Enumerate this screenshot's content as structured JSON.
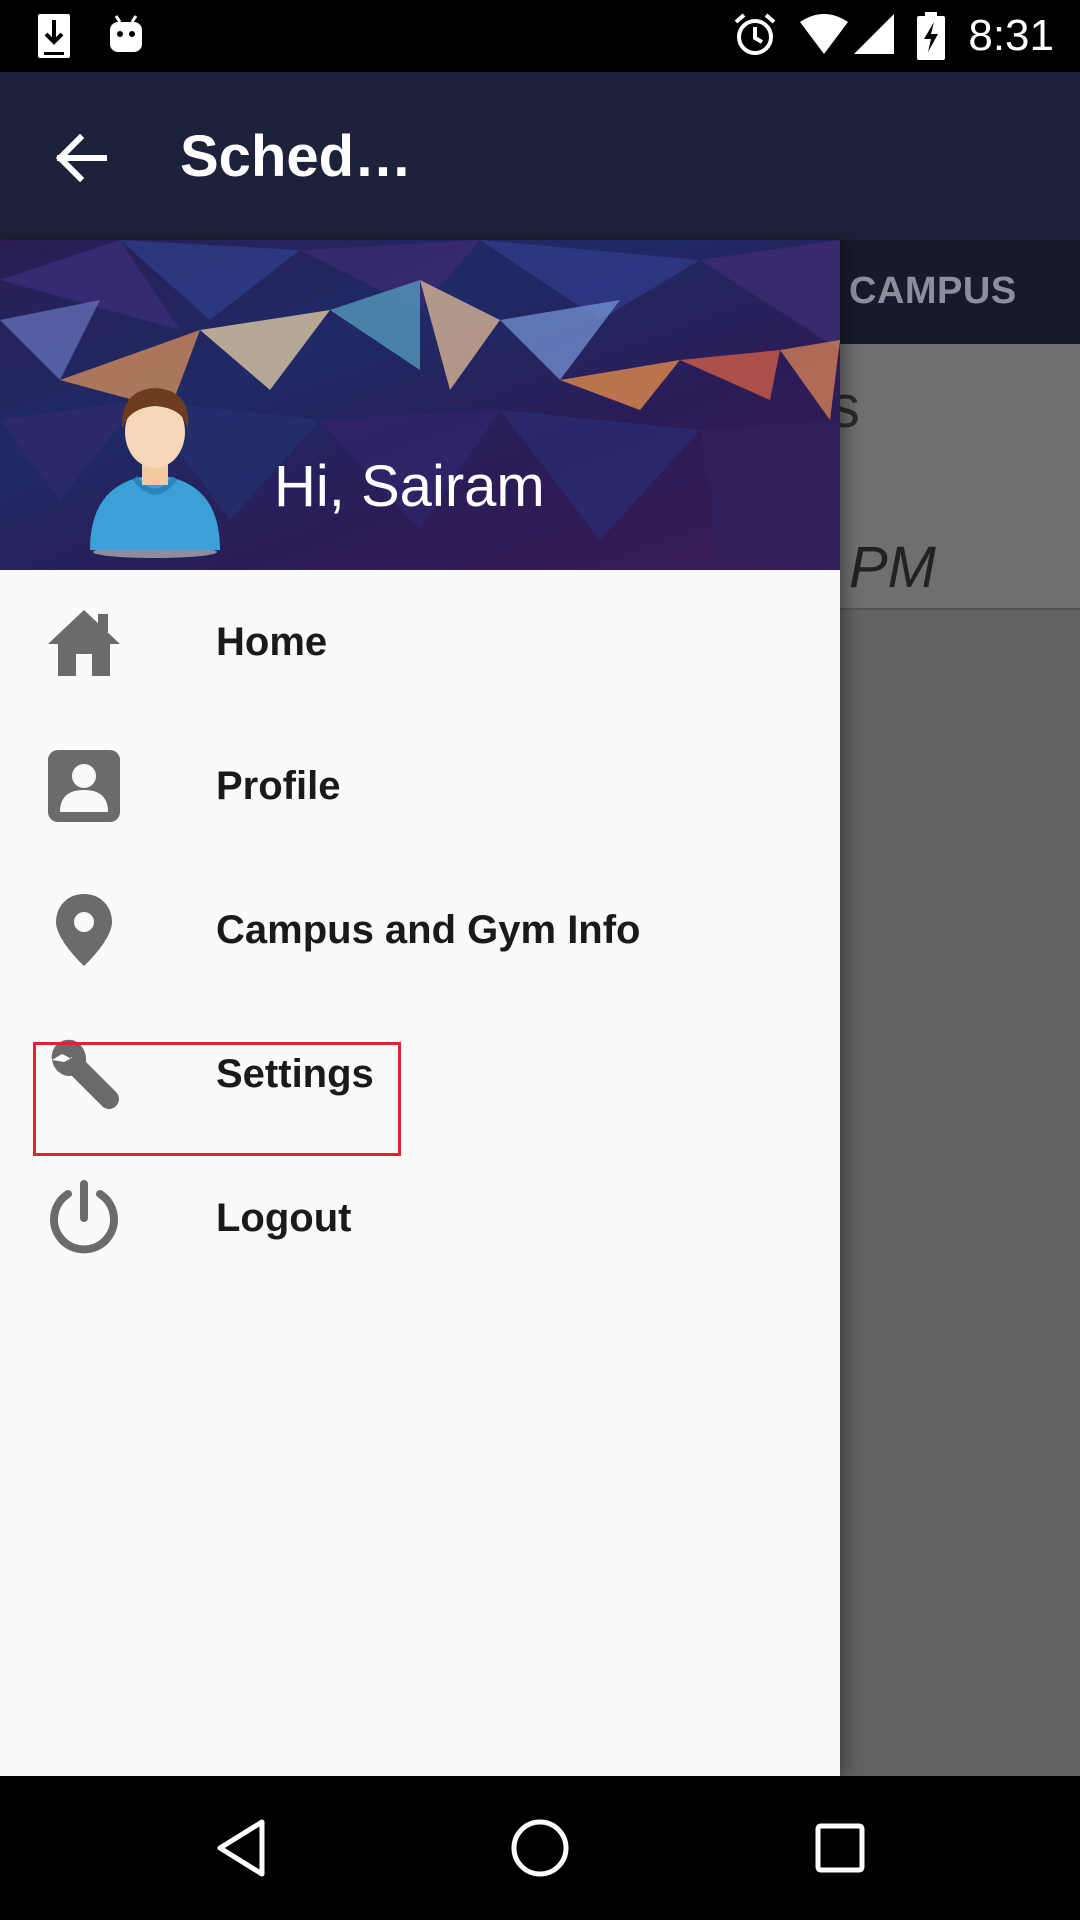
{
  "status_bar": {
    "time": "8:31",
    "icons": [
      "download-icon",
      "android-icon",
      "alarm-icon",
      "wifi-icon",
      "signal-icon",
      "battery-charging-icon"
    ]
  },
  "toolbar": {
    "title": "Sched…",
    "back_icon": "arrow-back-icon"
  },
  "background_app": {
    "tab_label": "CAMPUS",
    "text_fragment_s": "s",
    "text_fragment_pm": "PM"
  },
  "drawer": {
    "greeting": "Hi, Sairam",
    "items": [
      {
        "label": "Home",
        "icon": "home-icon"
      },
      {
        "label": "Profile",
        "icon": "profile-icon"
      },
      {
        "label": "Campus and Gym Info",
        "icon": "location-pin-icon"
      },
      {
        "label": "Settings",
        "icon": "wrench-icon",
        "highlighted": true
      },
      {
        "label": "Logout",
        "icon": "power-icon"
      }
    ]
  },
  "nav_bar": {
    "buttons": [
      "back-nav-icon",
      "home-nav-icon",
      "recents-nav-icon"
    ]
  },
  "colors": {
    "toolbar": "#1d2139",
    "drawer_bg": "#fafafa",
    "icon_gray": "#6b6b6b",
    "highlight": "#e0242f",
    "scrim": "#626262"
  }
}
